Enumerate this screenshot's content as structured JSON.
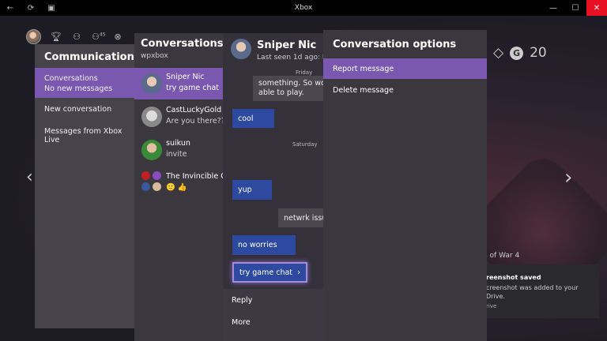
{
  "window": {
    "title": "Xbox",
    "controls": {
      "minimize": "—",
      "maximize": "☐",
      "close": "✕"
    }
  },
  "topnav": {
    "icons": [
      "avatar",
      "trophy-icon",
      "friends-icon",
      "party-icon",
      "xbox-icon"
    ],
    "party_count": "45"
  },
  "rewards": {
    "gem_icon": "gem-icon",
    "badge": "G",
    "score": "20"
  },
  "communication": {
    "title": "Communication",
    "items": [
      {
        "label": "Conversations",
        "sublabel": "No new messages",
        "active": true
      },
      {
        "label": "New conversation"
      },
      {
        "label": "Messages from Xbox Live"
      }
    ]
  },
  "conversations": {
    "title": "Conversations",
    "subtitle": "wpxbox",
    "items": [
      {
        "name": "Sniper Nic",
        "message": "try game chat",
        "active": true
      },
      {
        "name": "CastLuckyGold",
        "message": "Are you there??"
      },
      {
        "name": "suikun",
        "message": "invite"
      },
      {
        "name": "The Invincible G",
        "message": "🙂 👍"
      }
    ]
  },
  "chat": {
    "name": "Sniper Nic",
    "last_seen": "Last seen 1d ago: H",
    "day1": "Friday",
    "day2": "Saturday",
    "messages": [
      {
        "text": "something. So wo",
        "dir": "in"
      },
      {
        "text": "able to play.",
        "dir": "in"
      },
      {
        "text": "cool",
        "dir": "out"
      },
      {
        "text": "yup",
        "dir": "out"
      },
      {
        "text": "netwrk issu",
        "dir": "in"
      },
      {
        "text": "no worries",
        "dir": "out"
      },
      {
        "text": "try game chat",
        "dir": "out",
        "selected": true
      }
    ],
    "menu": [
      "Reply",
      "More"
    ]
  },
  "options": {
    "title": "Conversation options",
    "items": [
      {
        "label": "Report message",
        "active": true
      },
      {
        "label": "Delete message"
      }
    ]
  },
  "background": {
    "game_title": "s of War 4",
    "toast_title": "reenshot saved",
    "toast_body": "creenshot was added to your Drive.",
    "toast_extra": "rive"
  },
  "colors": {
    "accent": "#7b58b0",
    "outgoing_bubble": "#2e4aa0",
    "close_button": "#e81123"
  }
}
